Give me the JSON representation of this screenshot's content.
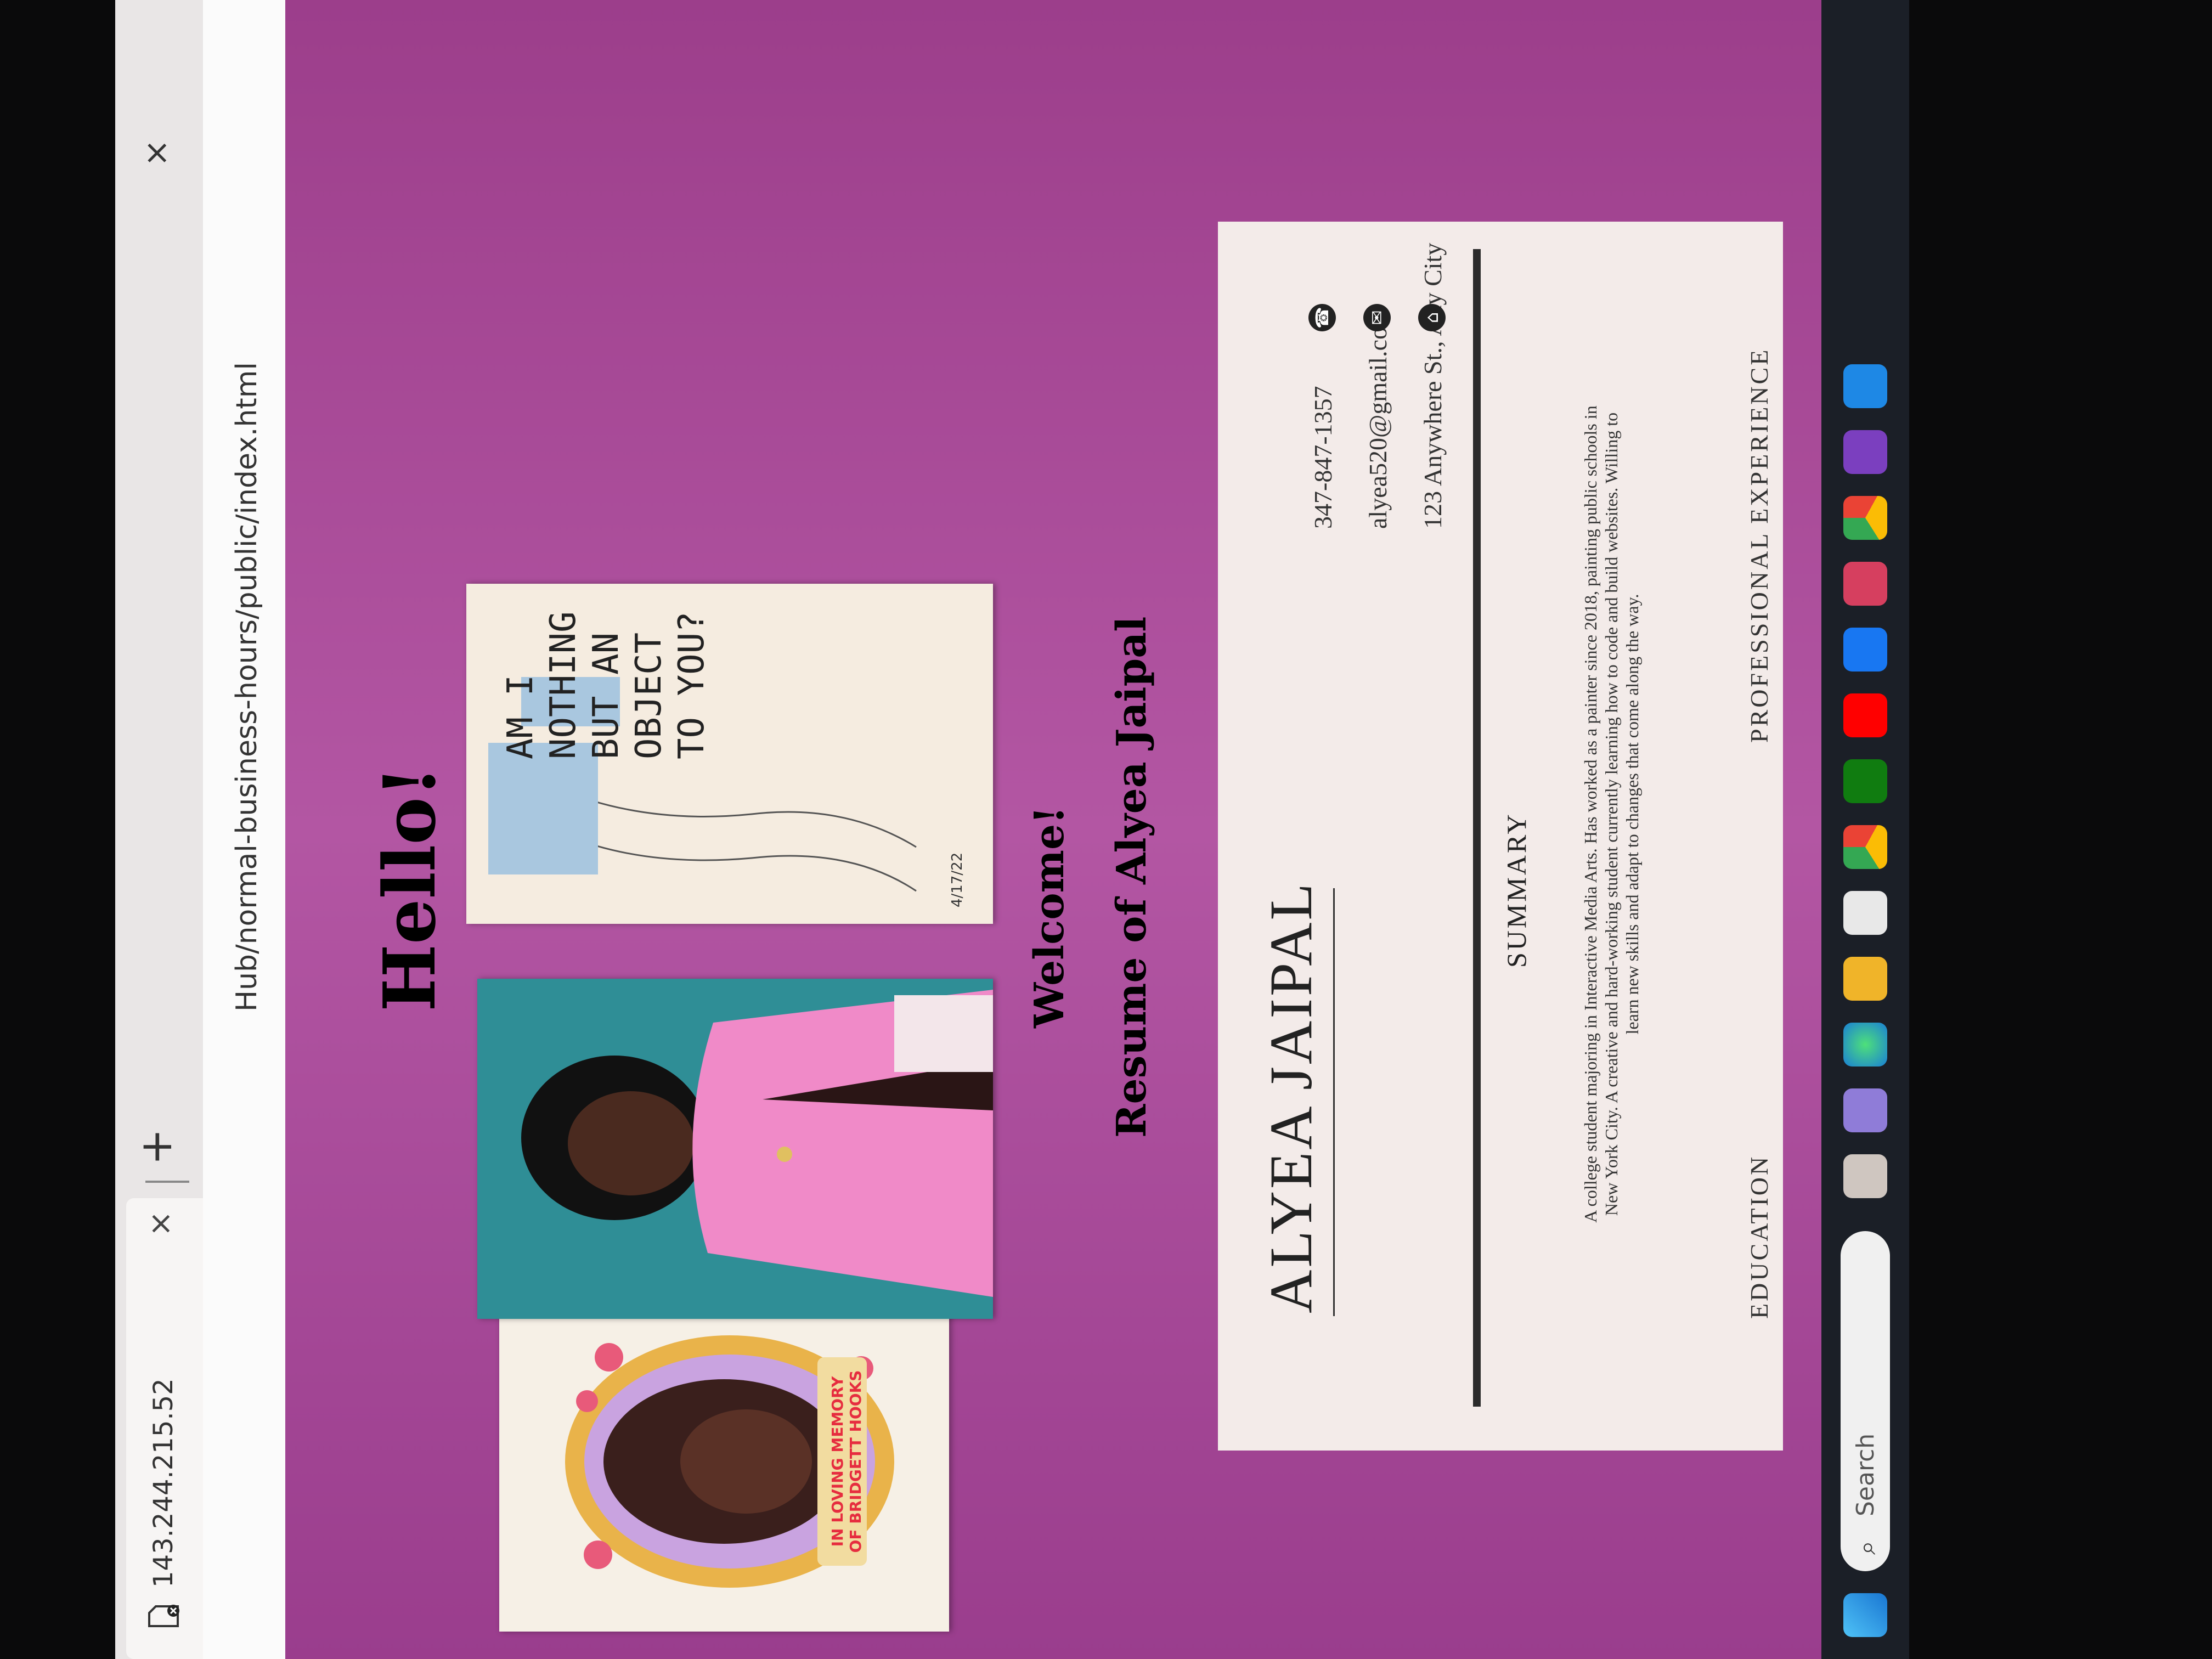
{
  "browser": {
    "tab_title": "143.244.215.52",
    "tab_close": "×",
    "new_tab": "+",
    "window_close": "×",
    "url": "Hub/normal-business-hours/public/index.html"
  },
  "page": {
    "heading": "Hello!",
    "welcome": "Welcome!",
    "resume_title": "Resume of Alyea Jaipal",
    "artwork1_caption": "IN LOVING MEMORY OF BRIDGETT HOOKS",
    "artwork3_text": "AM I NOTHING BUT AN OBJECT TO YOU?",
    "artwork3_date": "4/17/22"
  },
  "resume": {
    "name": "ALYEA JAIPAL",
    "phone": "347-847-1357",
    "email": "alyea520@gmail.com",
    "address": "123 Anywhere St., Any City",
    "summary_heading": "SUMMARY",
    "summary_text": "A college student majoring in Interactive Media Arts. Has worked as a painter since 2018, painting public schools in New York City. A creative and hard-working student currently learning how to code and build websites. Willing to learn new skills and adapt to changes that come along the way.",
    "education_heading": "EDUCATION",
    "experience_heading": "PROFESSIONAL EXPERIENCE"
  },
  "taskbar": {
    "search_label": "Search",
    "icons": [
      "windows-icon",
      "search-icon",
      "widgets-icon",
      "file-explorer-icon",
      "edge-icon",
      "folder-icon",
      "store-icon",
      "chrome-icon",
      "xbox-icon",
      "youtube-icon",
      "facebook-icon",
      "mail-icon",
      "chrome-profile-icon",
      "copilot-icon",
      "vscode-icon"
    ]
  },
  "colors": {
    "page_bg": "#a2408f",
    "resume_bg": "#f3ebe9",
    "taskbar_bg": "#1b1f27"
  }
}
